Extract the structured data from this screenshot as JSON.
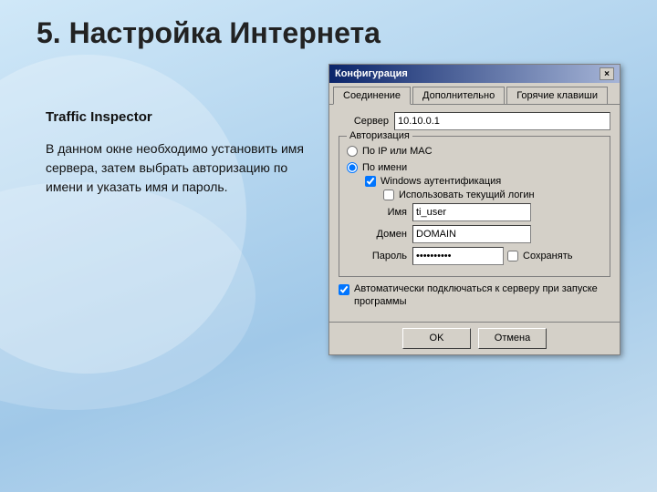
{
  "page": {
    "title": "5. Настройка Интернета"
  },
  "left": {
    "app_name": "Traffic Inspector",
    "description": "В данном окне необходимо установить имя сервера, затем выбрать авторизацию по имени и указать имя и пароль."
  },
  "dialog": {
    "title": "Конфигурация",
    "close_btn": "×",
    "tabs": [
      {
        "label": "Соединение",
        "active": true
      },
      {
        "label": "Дополнительно",
        "active": false
      },
      {
        "label": "Горячие клавиши",
        "active": false
      }
    ],
    "server_label": "Сервер",
    "server_value": "10.10.0.1",
    "auth_group": "Авторизация",
    "radio_ip_mac": "По IP или MAC",
    "radio_by_name": "По имени",
    "cb_windows_auth": "Windows аутентификация",
    "cb_use_current": "Использовать текущий логин",
    "name_label": "Имя",
    "name_value": "ti_user",
    "domain_label": "Домен",
    "domain_value": "DOMAIN",
    "password_label": "Пароль",
    "password_value": "**********",
    "save_label": "Сохранять",
    "auto_connect_cb": "",
    "auto_connect_text": "Автоматически подключаться к серверу при запуске программы",
    "btn_ok": "OK",
    "btn_cancel": "Отмена"
  }
}
